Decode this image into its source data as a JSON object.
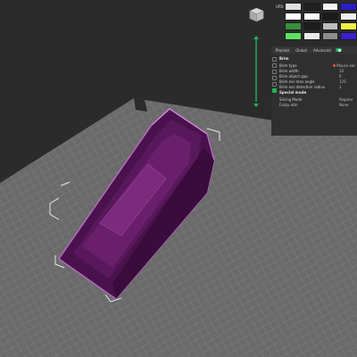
{
  "viewport": {
    "bed_color": "#6e6e6e",
    "model_color": "#5c1a5e",
    "highlight_color": "#c36fd0"
  },
  "materials": {
    "row_label": "UPD",
    "row1": [
      "",
      "",
      "",
      "",
      ""
    ],
    "row2": [
      "",
      "",
      "",
      "",
      ""
    ],
    "row3": [
      "",
      "",
      "",
      "",
      ""
    ],
    "row4": [
      "",
      "",
      "",
      "",
      ""
    ],
    "colors": {
      "row1": [
        "#e0e0e0",
        "#202020",
        "#f4f4f4",
        "#f2f2f2",
        "#2a1ec8"
      ],
      "row2": [
        "#ffffff",
        "#ffffff",
        "#1a1a1a",
        "#f0f0f0",
        "#ffffff"
      ],
      "row3": [
        "#3a8f3a",
        "#1c1c1c",
        "#bdbdbd",
        "#f0f040",
        "#e8e8e8"
      ],
      "row4": [
        "#5ee05e",
        "#eaeaea",
        "#8d8d8d",
        "#e8e8e8",
        "#3b1fd1"
      ]
    }
  },
  "panel": {
    "tabs": [
      "Process",
      "Global",
      "Advanced"
    ],
    "section1": "Brim",
    "rows1": [
      {
        "label": "Brim type",
        "value": "Mouse ear"
      },
      {
        "label": "Brim width",
        "value": "10"
      },
      {
        "label": "Brim object gap",
        "value": "0"
      },
      {
        "label": "Brim ear max angle",
        "value": "125"
      },
      {
        "label": "Brim ear detection radius",
        "value": "1"
      }
    ],
    "section2": "Special mode",
    "rows2": [
      {
        "label": "Slicing Mode",
        "value": "Regular"
      },
      {
        "label": "Fuzzy skin",
        "value": "None"
      }
    ]
  },
  "slider": {
    "color": "#1fb45a"
  }
}
